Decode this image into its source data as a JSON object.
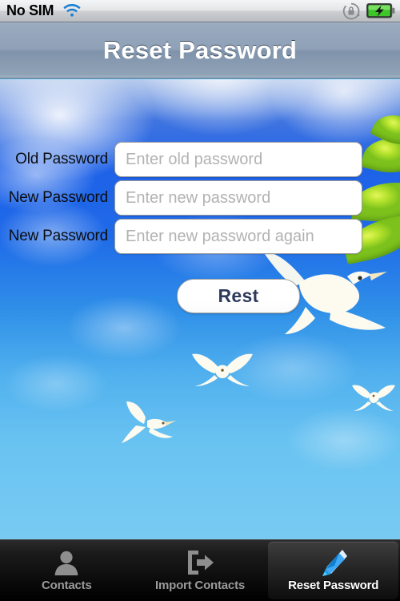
{
  "status_bar": {
    "carrier": "No SIM",
    "wifi_icon": "wifi-icon",
    "rotation_lock_icon": "rotation-lock-icon",
    "battery_icon": "battery-charging-icon"
  },
  "nav_bar": {
    "title": "Reset Password"
  },
  "form": {
    "fields": [
      {
        "label": "Old Password",
        "placeholder": "Enter old password",
        "value": ""
      },
      {
        "label": "New Password",
        "placeholder": "Enter new password",
        "value": ""
      },
      {
        "label": "New Password",
        "placeholder": "Enter new password again",
        "value": ""
      }
    ],
    "submit_label": "Rest"
  },
  "tab_bar": {
    "tabs": [
      {
        "label": "Contacts",
        "icon": "person-icon",
        "selected": false
      },
      {
        "label": "Import Contacts",
        "icon": "import-arrow-icon",
        "selected": false
      },
      {
        "label": "Reset Password",
        "icon": "pencil-icon",
        "selected": true
      }
    ]
  },
  "colors": {
    "sky_top": "#1e62e8",
    "sky_bottom": "#72c8f2",
    "nav_bar": "#8fa1b7",
    "leaf_green": "#b5e32e",
    "button_text": "#2d3a5c",
    "tab_selected_text": "#ffffff",
    "tab_text": "#9b9b9b"
  }
}
